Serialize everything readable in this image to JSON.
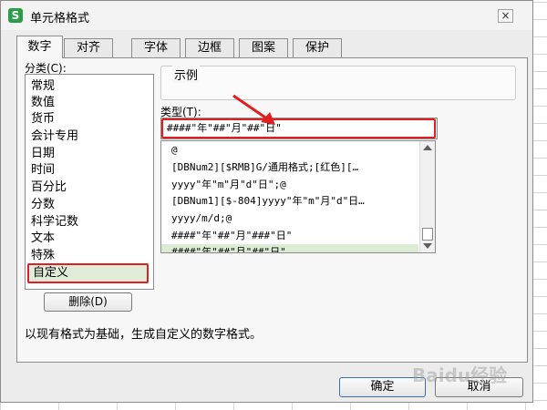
{
  "window": {
    "title": "单元格格式",
    "app_icon_letter": "S",
    "close_glyph": "×"
  },
  "tabs": [
    {
      "label": "数字",
      "active": true
    },
    {
      "label": "对齐",
      "active": false
    },
    {
      "label": "字体",
      "active": false
    },
    {
      "label": "边框",
      "active": false
    },
    {
      "label": "图案",
      "active": false
    },
    {
      "label": "保护",
      "active": false
    }
  ],
  "category": {
    "label": "分类(C):",
    "items": [
      "常规",
      "数值",
      "货币",
      "会计专用",
      "日期",
      "时间",
      "百分比",
      "分数",
      "科学记数",
      "文本",
      "特殊",
      "自定义"
    ],
    "selected": "自定义"
  },
  "sample": {
    "label": "示例",
    "value": ""
  },
  "type": {
    "label": "类型(T):",
    "value": "####\"年\"##\"月\"##\"日\""
  },
  "format_list": {
    "items": [
      "@",
      "[DBNum2][$RMB]G/通用格式;[红色][…",
      "yyyy\"年\"m\"月\"d\"日\";@",
      "[DBNum1][$-804]yyyy\"年\"m\"月\"d\"日…",
      "yyyy/m/d;@",
      "####\"年\"##\"月\"###\"日\"",
      "####\"年\"##\"月\"##\"日\""
    ],
    "selected_index": 6
  },
  "buttons": {
    "delete": "删除(D)",
    "ok": "确定",
    "cancel": "取消"
  },
  "description": "以现有格式为基础，生成自定义的数字格式。",
  "watermark": "Baidu经验",
  "colors": {
    "highlight_red": "#e02020",
    "selection_green": "#dcebd4",
    "app_green": "#2a9d48"
  }
}
